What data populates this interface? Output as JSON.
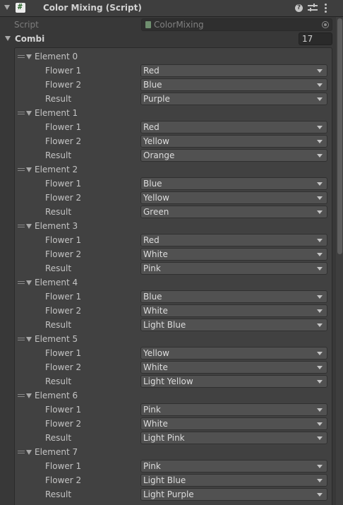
{
  "header": {
    "title": "Color Mixing (Script)",
    "help_icon": "help-icon",
    "preset_icon": "presets-icon",
    "more_icon": "more-vert-icon"
  },
  "script": {
    "label": "Script",
    "value": "ColorMixing"
  },
  "combi": {
    "label": "Combi",
    "size": "17"
  },
  "field_labels": {
    "flower1": "Flower 1",
    "flower2": "Flower 2",
    "result": "Result"
  },
  "elements": [
    {
      "label": "Element 0",
      "flower1": "Red",
      "flower2": "Blue",
      "result": "Purple"
    },
    {
      "label": "Element 1",
      "flower1": "Red",
      "flower2": "Yellow",
      "result": "Orange"
    },
    {
      "label": "Element 2",
      "flower1": "Blue",
      "flower2": "Yellow",
      "result": "Green"
    },
    {
      "label": "Element 3",
      "flower1": "Red",
      "flower2": "White",
      "result": "Pink"
    },
    {
      "label": "Element 4",
      "flower1": "Blue",
      "flower2": "White",
      "result": "Light Blue"
    },
    {
      "label": "Element 5",
      "flower1": "Yellow",
      "flower2": "White",
      "result": "Light Yellow"
    },
    {
      "label": "Element 6",
      "flower1": "Pink",
      "flower2": "White",
      "result": "Light Pink"
    },
    {
      "label": "Element 7",
      "flower1": "Pink",
      "flower2": "Light Blue",
      "result": "Light Purple"
    }
  ]
}
